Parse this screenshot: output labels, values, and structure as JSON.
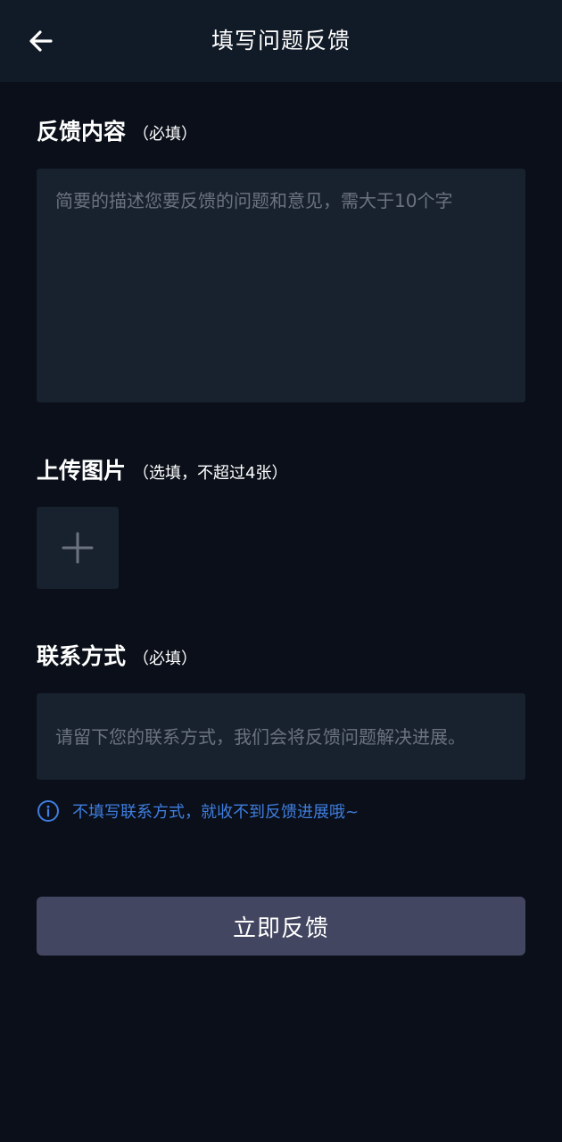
{
  "header": {
    "title": "填写问题反馈",
    "back_icon": "arrow-left-icon"
  },
  "feedback": {
    "title": "反馈内容",
    "note": "（必填）",
    "placeholder": "简要的描述您要反馈的问题和意见，需大于10个字",
    "value": ""
  },
  "images": {
    "title": "上传图片",
    "note": "（选填，不超过4张）",
    "add_icon": "plus-icon"
  },
  "contact": {
    "title": "联系方式",
    "note": "（必填）",
    "placeholder": "请留下您的联系方式，我们会将反馈问题解决进展。",
    "value": ""
  },
  "hint": {
    "icon": "info-icon",
    "text": "不填写联系方式，就收不到反馈进展哦~"
  },
  "submit": {
    "label": "立即反馈"
  },
  "colors": {
    "background": "#0a0f19",
    "header_background": "#111a27",
    "field_background": "#18212e",
    "placeholder": "#6b7380",
    "hint_accent": "#3f7ee0",
    "submit_button": "#434660"
  }
}
